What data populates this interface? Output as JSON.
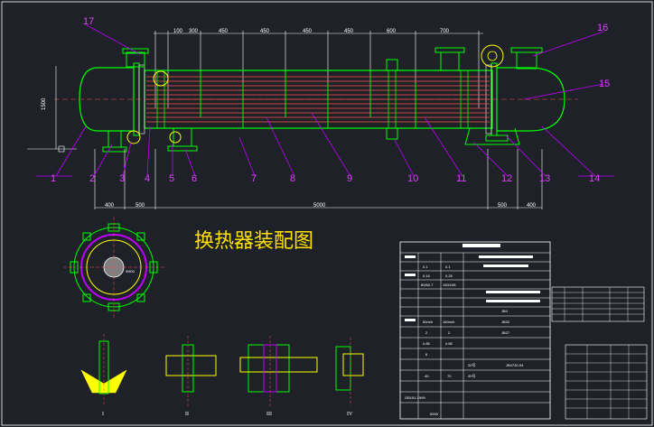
{
  "drawing": {
    "title": "换热器装配图",
    "part_numbers": [
      "1",
      "2",
      "3",
      "4",
      "5",
      "6",
      "7",
      "8",
      "9",
      "10",
      "11",
      "12",
      "13",
      "14",
      "15",
      "16",
      "17"
    ],
    "top_dimensions": [
      "100",
      "300",
      "450",
      "450",
      "450",
      "450",
      "600",
      "700"
    ],
    "bottom_dimensions": [
      "400",
      "500",
      "5000",
      "500",
      "400"
    ],
    "height_dimension": "1500",
    "detail_labels": [
      "I",
      "II",
      "III",
      "IV"
    ],
    "detail_label_main": "III",
    "detail_label_side": "II",
    "detail_label_small": "I",
    "detail_label_iv": "IV",
    "shell_diameter_label": "Φ800"
  },
  "colors": {
    "background": "#1e2127",
    "shell": "#00ff00",
    "leader": "#c000ff",
    "tubes": "#ff5050",
    "flange": "#ffff00",
    "text": "#ffffff",
    "title": "#ffe000"
  },
  "tech_table": {
    "values_col1": [
      "0.1",
      "0.15",
      "80/60.7",
      "120",
      "50m/h",
      "2",
      "0.85",
      "6",
      "40"
    ],
    "values_col2": [
      "0.1",
      "0.25",
      "150/108",
      "",
      "160m/h",
      "2",
      "0.85",
      "",
      "70"
    ],
    "spec_rows": [
      "JB4",
      "JB32",
      "JB27"
    ],
    "bottom_ref": "GB151-1999",
    "stamp": "5000"
  },
  "parts_list": {
    "rows": [
      "20号",
      "20号",
      "JB4730-94"
    ]
  }
}
